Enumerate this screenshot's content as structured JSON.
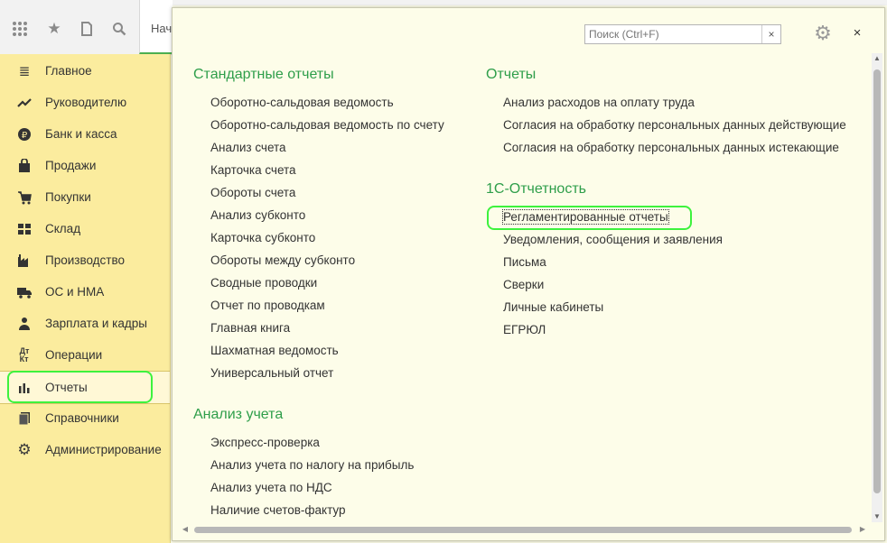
{
  "toolbar": {
    "apps_icon": "grid-icon",
    "favorites_icon": "star-icon",
    "history_icon": "history-icon",
    "search_icon": "search-icon",
    "tab_label": "Нач"
  },
  "sidebar": {
    "items": [
      {
        "label": "Главное",
        "icon": "menu-lines-icon"
      },
      {
        "label": "Руководителю",
        "icon": "trend-icon"
      },
      {
        "label": "Банк и касса",
        "icon": "ruble-icon"
      },
      {
        "label": "Продажи",
        "icon": "bag-icon"
      },
      {
        "label": "Покупки",
        "icon": "cart-icon"
      },
      {
        "label": "Склад",
        "icon": "boxes-icon"
      },
      {
        "label": "Производство",
        "icon": "factory-icon"
      },
      {
        "label": "ОС и НМА",
        "icon": "truck-icon"
      },
      {
        "label": "Зарплата и кадры",
        "icon": "people-icon"
      },
      {
        "label": "Операции",
        "icon": "dt-kt-icon"
      },
      {
        "label": "Отчеты",
        "icon": "bar-chart-icon"
      },
      {
        "label": "Справочники",
        "icon": "book-icon"
      },
      {
        "label": "Администрирование",
        "icon": "gear-icon"
      }
    ],
    "active_label": "Отчеты"
  },
  "panel": {
    "search_placeholder": "Поиск (Ctrl+F)",
    "search_clear": "×",
    "close": "×",
    "sections": {
      "standard": {
        "title": "Стандартные отчеты",
        "items": [
          "Оборотно-сальдовая ведомость",
          "Оборотно-сальдовая ведомость по счету",
          "Анализ счета",
          "Карточка счета",
          "Обороты счета",
          "Анализ субконто",
          "Карточка субконто",
          "Обороты между субконто",
          "Сводные проводки",
          "Отчет по проводкам",
          "Главная книга",
          "Шахматная ведомость",
          "Универсальный отчет"
        ]
      },
      "analysis": {
        "title": "Анализ учета",
        "items": [
          "Экспресс-проверка",
          "Анализ учета по налогу на прибыль",
          "Анализ учета по НДС",
          "Наличие счетов-фактур"
        ]
      },
      "reports": {
        "title": "Отчеты",
        "items": [
          "Анализ расходов на оплату труда",
          "Согласия на обработку персональных данных действующие",
          "Согласия на обработку персональных данных истекающие"
        ]
      },
      "reporting": {
        "title": "1С-Отчетность",
        "items": [
          "Регламентированные отчеты",
          "Уведомления, сообщения и заявления",
          "Письма",
          "Сверки",
          "Личные кабинеты",
          "ЕГРЮЛ"
        ]
      }
    }
  },
  "colors": {
    "sidebar_bg": "#fbec9e",
    "panel_bg": "#fdfde9",
    "section_title": "#2e9e4a",
    "highlight": "#3df23d"
  }
}
